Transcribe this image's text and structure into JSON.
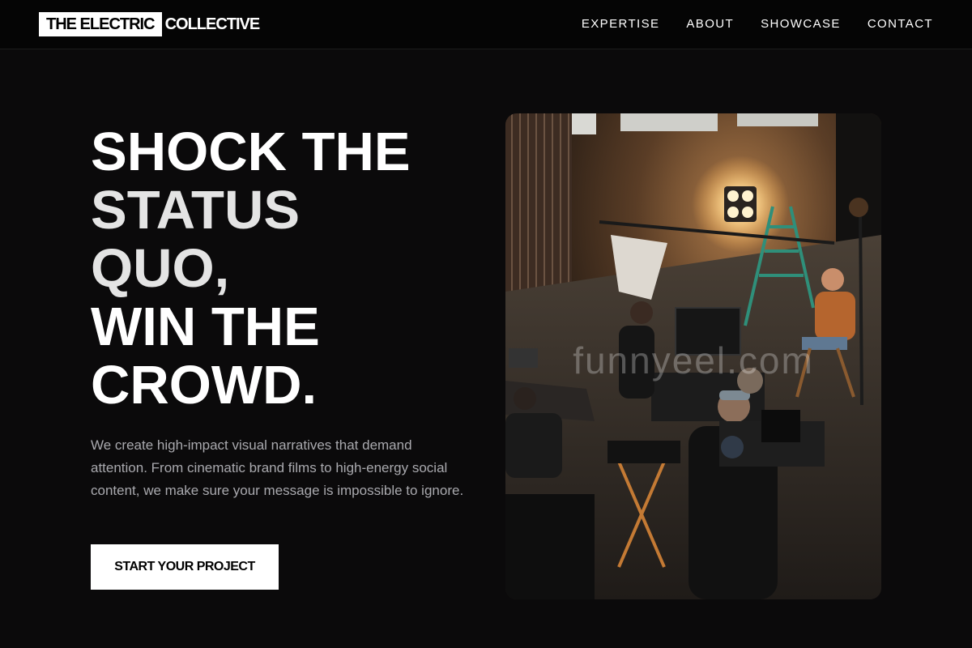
{
  "brand": {
    "boxed": "THE ELECTRIC",
    "rest": "COLLECTIVE"
  },
  "nav": {
    "items": [
      {
        "label": "EXPERTISE"
      },
      {
        "label": "ABOUT"
      },
      {
        "label": "SHOWCASE"
      },
      {
        "label": "CONTACT"
      }
    ]
  },
  "hero": {
    "headline_lines": [
      {
        "text": "SHOCK THE",
        "tone": "white"
      },
      {
        "text": "STATUS",
        "tone": "grey"
      },
      {
        "text": "QUO,",
        "tone": "grey"
      },
      {
        "text": "WIN THE",
        "tone": "white"
      },
      {
        "text": "CROWD.",
        "tone": "white"
      }
    ],
    "description": "We create high-impact visual narratives that demand attention. From cinematic brand films to high-energy social content, we make sure your message is impossible to ignore.",
    "cta_label": "START YOUR PROJECT",
    "image_watermark": "funnyeel.com"
  },
  "colors": {
    "background": "#0b0a0b",
    "header": "#050505",
    "accent": "#ffffff",
    "body_text": "#a9a9ae"
  }
}
